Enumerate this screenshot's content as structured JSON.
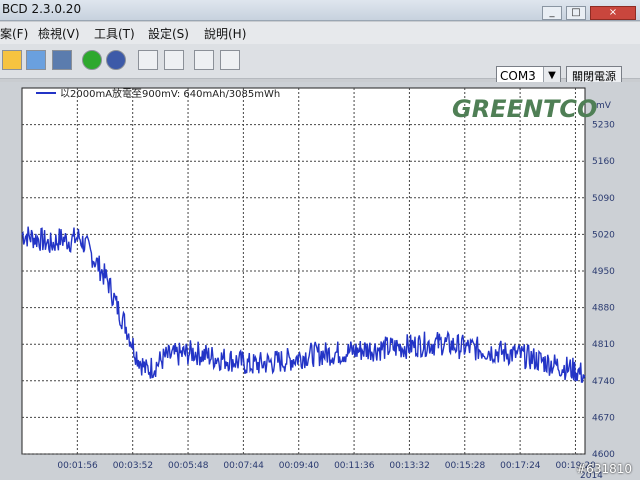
{
  "app": {
    "title": "BCD 2.3.0.20"
  },
  "menu": [
    {
      "label": "案(F)"
    },
    {
      "label": "檢視(V)"
    },
    {
      "label": "工具(T)"
    },
    {
      "label": "設定(S)"
    },
    {
      "label": "說明(H)"
    }
  ],
  "toolbar": {
    "port": "COM3",
    "power_button": "關閉電源"
  },
  "brand": {
    "logo": "GREENTCO"
  },
  "chart_data": {
    "type": "line",
    "legend": "以2000mA放電至900mV: 640mAh/3085mWh",
    "series_color": "#2334c6",
    "ylabel": "mV",
    "ylim": [
      4600,
      5300
    ],
    "y_ticks": [
      5230,
      5160,
      5090,
      5020,
      4950,
      4880,
      4810,
      4740,
      4670,
      4600
    ],
    "x_ticks": [
      "00:01:56",
      "00:03:52",
      "00:05:48",
      "00:07:44",
      "00:09:40",
      "00:11:36",
      "00:13:32",
      "00:15:28",
      "00:17:24",
      "00:19:20"
    ],
    "x_end_date": "2014",
    "x_seconds": [
      0,
      20,
      40,
      60,
      80,
      100,
      120,
      140,
      160,
      180,
      200,
      220,
      240,
      260,
      280,
      300,
      330,
      360,
      400,
      440,
      480,
      520,
      560,
      600,
      640,
      680,
      720,
      760,
      800,
      840,
      880,
      920,
      960,
      1000,
      1040,
      1080,
      1120,
      1160,
      1180
    ],
    "values": [
      5020,
      5015,
      5010,
      5000,
      5012,
      5008,
      5015,
      4990,
      4960,
      4930,
      4880,
      4840,
      4790,
      4760,
      4770,
      4785,
      4790,
      4795,
      4785,
      4780,
      4770,
      4775,
      4780,
      4790,
      4792,
      4795,
      4800,
      4802,
      4805,
      4810,
      4812,
      4805,
      4800,
      4795,
      4790,
      4780,
      4770,
      4760,
      4750
    ],
    "grid": true,
    "legend_position": "top-left"
  }
}
